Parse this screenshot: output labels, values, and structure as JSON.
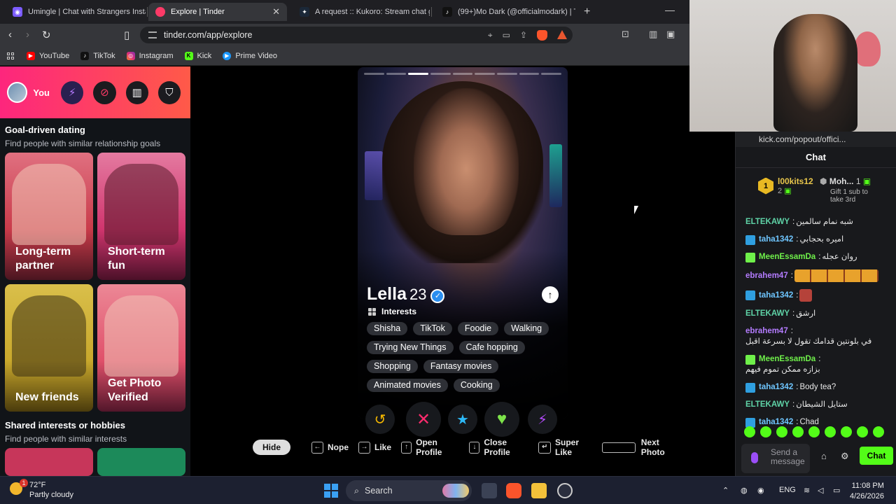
{
  "browser": {
    "tabs": [
      {
        "title": "Umingle | Chat with Strangers Instant",
        "active": false
      },
      {
        "title": "Explore | Tinder",
        "active": true
      },
      {
        "title": "A request :: Kukoro: Stream chat gam",
        "active": false
      },
      {
        "title": "(99+)Mo Dark (@officialmodark) | Tik",
        "active": false
      }
    ],
    "url": "tinder.com/app/explore",
    "bookmarks": [
      "YouTube",
      "TikTok",
      "Instagram",
      "Kick",
      "Prime Video"
    ]
  },
  "sidebar": {
    "you_label": "You",
    "section1": {
      "title": "Goal-driven dating",
      "subtitle": "Find people with similar relationship goals"
    },
    "cards": [
      {
        "label": "Long-term partner",
        "color": "#c93b4a"
      },
      {
        "label": "Short-term fun",
        "color": "#d0356e"
      },
      {
        "label": "New friends",
        "color": "#c9a82c"
      },
      {
        "label": "Get Photo Verified",
        "color": "#e0506a"
      }
    ],
    "section2": {
      "title": "Shared interests or hobbies",
      "subtitle": "Find people with similar interests"
    }
  },
  "profile": {
    "name": "Lella",
    "age": "23",
    "interests_label": "Interests",
    "interests": [
      "Shisha",
      "TikTok",
      "Foodie",
      "Walking",
      "Trying New Things",
      "Cafe hopping",
      "Shopping",
      "Fantasy movies",
      "Animated movies",
      "Cooking"
    ],
    "photo_count": 9,
    "current_photo": 3
  },
  "shortcuts": {
    "hide": "Hide",
    "items": [
      {
        "key": "←",
        "label": "Nope"
      },
      {
        "key": "→",
        "label": "Like"
      },
      {
        "key": "↑",
        "label": "Open Profile"
      },
      {
        "key": "↓",
        "label": "Close Profile"
      },
      {
        "key": "↵",
        "label": "Super Like"
      },
      {
        "key": "",
        "label": "Next Photo"
      }
    ]
  },
  "chat": {
    "url": "kick.com/popout/offici...",
    "title": "Chat",
    "top_gifters": [
      {
        "name": "l00kits12",
        "count": "2"
      },
      {
        "name": "Moh...",
        "count": "1"
      }
    ],
    "gift_prompt": "Gift 1 sub to take 3rd",
    "messages": [
      {
        "user": "ELTEKAWY",
        "text": "شبه نمام سالمين",
        "color": "#5fd3a7"
      },
      {
        "user": "taha1342",
        "text": "اميره بحجابي",
        "color": "#6fc6ff"
      },
      {
        "user": "MeenEssamDa",
        "text": "روان عجله",
        "color": "#6ff04a"
      },
      {
        "user": "ebrahem47",
        "text": "",
        "color": "#b47cff"
      },
      {
        "user": "taha1342",
        "text": "",
        "color": "#6fc6ff"
      },
      {
        "user": "ELTEKAWY",
        "text": "ارشق",
        "color": "#5fd3a7"
      },
      {
        "user": "ebrahem47",
        "text": "في بلونتين قدامك تقول لا بسرعة اقبل",
        "color": "#b47cff"
      },
      {
        "user": "MeenEssamDa",
        "text": "بزازه ممكن تموم فيهم",
        "color": "#6ff04a"
      },
      {
        "user": "taha1342",
        "text": "Body tea?",
        "color": "#6fc6ff"
      },
      {
        "user": "ELTEKAWY",
        "text": "ستايل الشيطان",
        "color": "#5fd3a7"
      },
      {
        "user": "taha1342",
        "text": "Chad",
        "color": "#6fc6ff"
      }
    ],
    "send_placeholder": "Send a message",
    "chat_button": "Chat"
  },
  "taskbar": {
    "weather_temp": "72°F",
    "weather_desc": "Partly cloudy",
    "weather_badge": "1",
    "search": "Search",
    "lang": "ENG",
    "time": "11:08 PM",
    "date": "4/26/2026"
  }
}
